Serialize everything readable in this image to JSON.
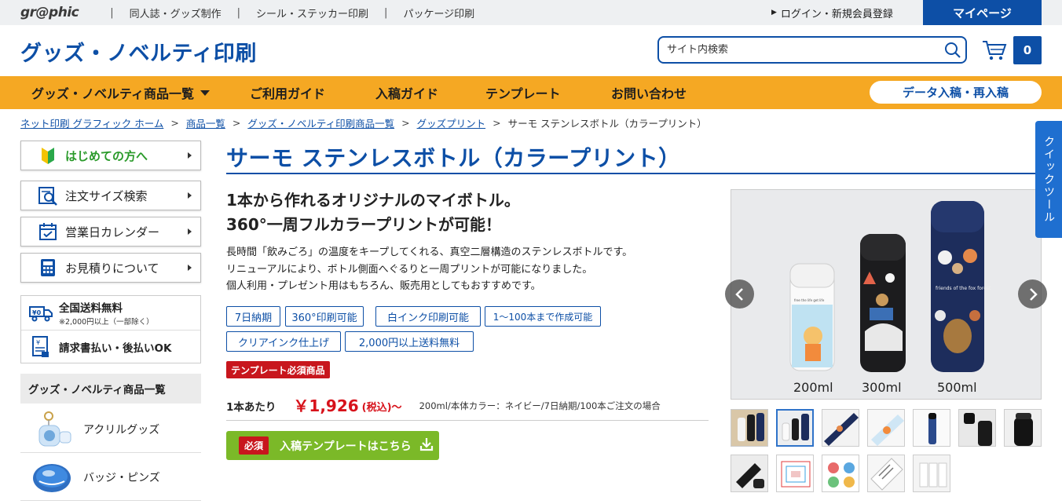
{
  "topbar": {
    "logo": "gr@phic",
    "links": [
      "同人誌・グッズ制作",
      "シール・ステッカー印刷",
      "パッケージ印刷"
    ],
    "separator": "|",
    "login": "ログイン・新規会員登録",
    "mypage": "マイページ"
  },
  "header": {
    "title": "グッズ・ノベルティ印刷",
    "search_placeholder": "サイト内検索",
    "cart_count": "0"
  },
  "nav": {
    "items": [
      "グッズ・ノベルティ商品一覧",
      "ご利用ガイド",
      "入稿ガイド",
      "テンプレート",
      "お問い合わせ"
    ],
    "data_button": "データ入稿・再入稿"
  },
  "breadcrumb": {
    "links": [
      "ネット印刷 グラフィック ホーム",
      "商品一覧",
      "グッズ・ノベルティ印刷商品一覧",
      "グッズプリント"
    ],
    "current": "サーモ ステンレスボトル（カラープリント）",
    "separator": ">"
  },
  "sidebar": {
    "buttons": [
      "はじめての方へ",
      "注文サイズ検索",
      "営業日カレンダー",
      "お見積りについて"
    ],
    "info": {
      "shipping_title": "全国送料無料",
      "shipping_note": "※2,000円以上（一部除く）",
      "invoice": "請求書払い・後払いOK"
    },
    "category_heading": "グッズ・ノベルティ商品一覧",
    "categories": [
      "アクリルグッズ",
      "バッジ・ピンズ"
    ]
  },
  "product": {
    "title": "サーモ ステンレスボトル（カラープリント）",
    "catch_line1": "1本から作れるオリジナルのマイボトル。",
    "catch_line2": "360°一周フルカラープリントが可能！",
    "desc_line1": "長時間「飲みごろ」の温度をキープしてくれる、真空二層構造のステンレスボトルです。",
    "desc_line2": "リニューアルにより、ボトル側面へぐるりと一周プリントが可能になりました。",
    "desc_line3": "個人利用・プレゼント用はもちろん、販売用としてもおすすめです。",
    "tags": [
      "7日納期",
      "360°印刷可能",
      "白インク印刷可能",
      "1〜100本まで作成可能",
      "クリアインク仕上げ",
      "2,000円以上送料無料"
    ],
    "template_required": "テンプレート必須商品",
    "price_label": "1本あたり",
    "price": "￥1,926",
    "tax": "(税込)〜",
    "price_note": "200ml/本体カラー：ネイビー/7日納期/100本ご注文の場合",
    "template_button_badge": "必須",
    "template_button": "入稿テンプレートはこちら"
  },
  "gallery": {
    "sizes": [
      "200ml",
      "300ml",
      "500ml"
    ],
    "bottle_text": "friends of the fox forest",
    "active_thumb_index": 1,
    "thumb_count": 12
  },
  "quick_tool": "クイックツール",
  "colors": {
    "brand_blue": "#0d4fa6",
    "nav_orange": "#f5a823",
    "price_red": "#d7121b",
    "button_green": "#7bb928",
    "badge_red": "#c8161d"
  }
}
